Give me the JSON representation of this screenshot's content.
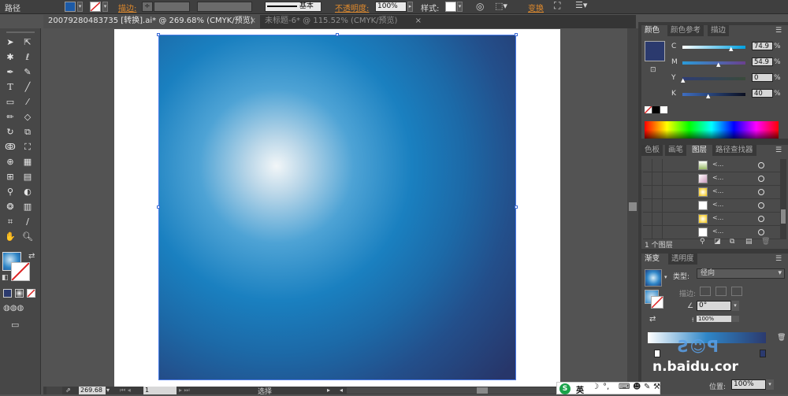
{
  "control_bar": {
    "selection_label": "路径",
    "fill_color": "#1c5aa6",
    "stroke_label": "描边:",
    "stroke_style": "基本",
    "opacity_label": "不透明度:",
    "opacity_value": "100%",
    "style_label": "样式:",
    "transform_label": "变换"
  },
  "tabs": [
    {
      "label": "20079280483735 [转换].ai* @ 269.68% (CMYK/预览)",
      "active": true
    },
    {
      "label": "未标题-6* @ 115.52% (CMYK/预览)",
      "active": false
    }
  ],
  "toolbox": {
    "fill_swatch_color": "#2f86c7",
    "tools": [
      "selection-icon",
      "direct-selection-icon",
      "magic-wand-icon",
      "lasso-icon",
      "pen-icon",
      "curvature-icon",
      "type-icon",
      "line-icon",
      "rectangle-icon",
      "paintbrush-icon",
      "pencil-icon",
      "eraser-icon",
      "rotate-icon",
      "scale-icon",
      "warp-icon",
      "free-transform-icon",
      "shape-builder-icon",
      "perspective-icon",
      "mesh-icon",
      "gradient-icon",
      "eyedropper-icon",
      "blend-icon",
      "symbol-sprayer-icon",
      "graph-icon",
      "artboard-icon",
      "slice-icon",
      "hand-icon",
      "zoom-icon"
    ]
  },
  "status_bar": {
    "zoom": "269.68",
    "page": "1",
    "tool_name": "选择"
  },
  "color_panel": {
    "tabs": [
      "颜色",
      "颜色参考",
      "描边"
    ],
    "swatch_color": "#2b3a6e",
    "sliders": [
      {
        "label": "C",
        "value": "74.9",
        "fraction": 0.749
      },
      {
        "label": "M",
        "value": "54.9",
        "fraction": 0.549
      },
      {
        "label": "Y",
        "value": "0",
        "fraction": 0.0
      },
      {
        "label": "K",
        "value": "40",
        "fraction": 0.4
      }
    ]
  },
  "layers_panel": {
    "tabs": [
      "色板",
      "画笔",
      "图层",
      "路径查找器"
    ],
    "rows": [
      "<...",
      "<...",
      "<...",
      "<...",
      "<...",
      "<..."
    ],
    "footer": "1 个图层"
  },
  "gradient_panel": {
    "tabs": [
      "渐变",
      "透明度"
    ],
    "type_label": "类型:",
    "type_value": "径向",
    "stroke_label": "描边:",
    "angle_value": "0°",
    "aspect_value": "100%",
    "location_label": "位置:",
    "location_value": "100%"
  },
  "taskbar": {
    "ime_label": "英"
  },
  "watermark": {
    "text": "n.baidu.cor"
  }
}
